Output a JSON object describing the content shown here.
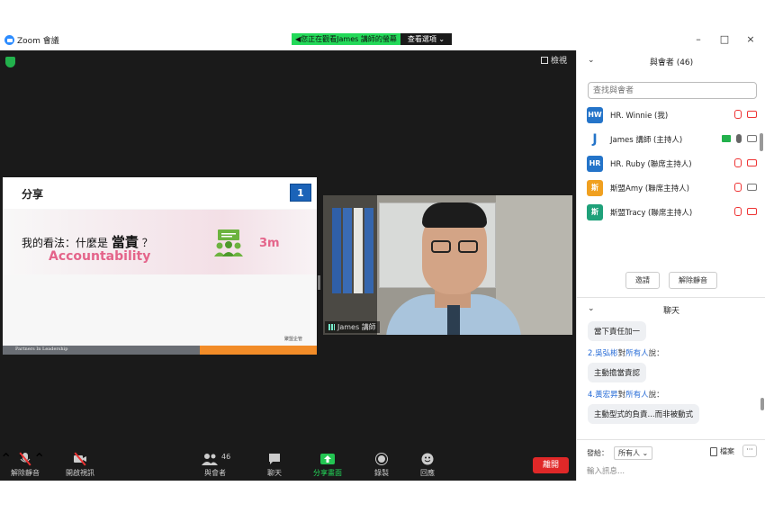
{
  "titlebar": {
    "app_title": "Zoom 會議",
    "share_message": "您正在觀看James 講師的螢幕",
    "view_options": "查看選項",
    "min_glyph": "–",
    "max_glyph": "□",
    "close_glyph": "×"
  },
  "stage": {
    "view_label": "檢視"
  },
  "slide": {
    "title": "分享",
    "number": "1",
    "question_prefix": "我的看法：什麼是",
    "question_bold": "當責",
    "question_suffix": "？",
    "accountability": "Accountability",
    "time": "3m",
    "footer": "Partners In Leadership",
    "logo_text": "聚盟企管"
  },
  "video": {
    "name": "James 講師"
  },
  "toolbar": {
    "unmute": "解除靜音",
    "start_video": "開啟視訊",
    "participants": "與會者",
    "participants_count": "46",
    "chat": "聊天",
    "share_screen": "分享畫面",
    "record": "錄製",
    "reactions": "回應",
    "leave": "離開"
  },
  "panel": {
    "participants_title": "與會者 (46)",
    "search_placeholder": "查找與會者",
    "participants": [
      {
        "initials": "HW",
        "name": "HR. Winnie (我)",
        "color": "#2474c9"
      },
      {
        "initials": "J",
        "name": "James 講師 (主持人)",
        "color": "#ffffff"
      },
      {
        "initials": "HR",
        "name": "HR. Ruby (聯席主持人)",
        "color": "#2474c9"
      },
      {
        "initials": "斯",
        "name": "斯盟Amy (聯席主持人)",
        "color": "#f0a020"
      },
      {
        "initials": "斯",
        "name": "斯盟Tracy (聯席主持人)",
        "color": "#1fa17a"
      }
    ],
    "invite": "邀請",
    "unmute_all": "解除靜音",
    "chat_title": "聊天",
    "chat": [
      {
        "type": "bubble",
        "text": "當下責任加一"
      },
      {
        "type": "sender",
        "name": "2.吳弘彬",
        "suffix": "對",
        "to": "所有人",
        "said": "說："
      },
      {
        "type": "bubble",
        "text": "主動擔當責認"
      },
      {
        "type": "sender",
        "name": "4.黃宏昇",
        "suffix": "對",
        "to": "所有人",
        "said": "說："
      },
      {
        "type": "bubble",
        "text": "主動型式的負責...而非被動式"
      }
    ],
    "send_to_label": "發給：",
    "send_to_value": "所有人",
    "file_label": "檔案",
    "more": "···",
    "input_placeholder": "輸入訊息..."
  },
  "colors": {
    "accent_green": "#23d959",
    "leave_red": "#e02828",
    "slide_pink": "#e4648a",
    "slide_blue": "#1b63b8"
  }
}
